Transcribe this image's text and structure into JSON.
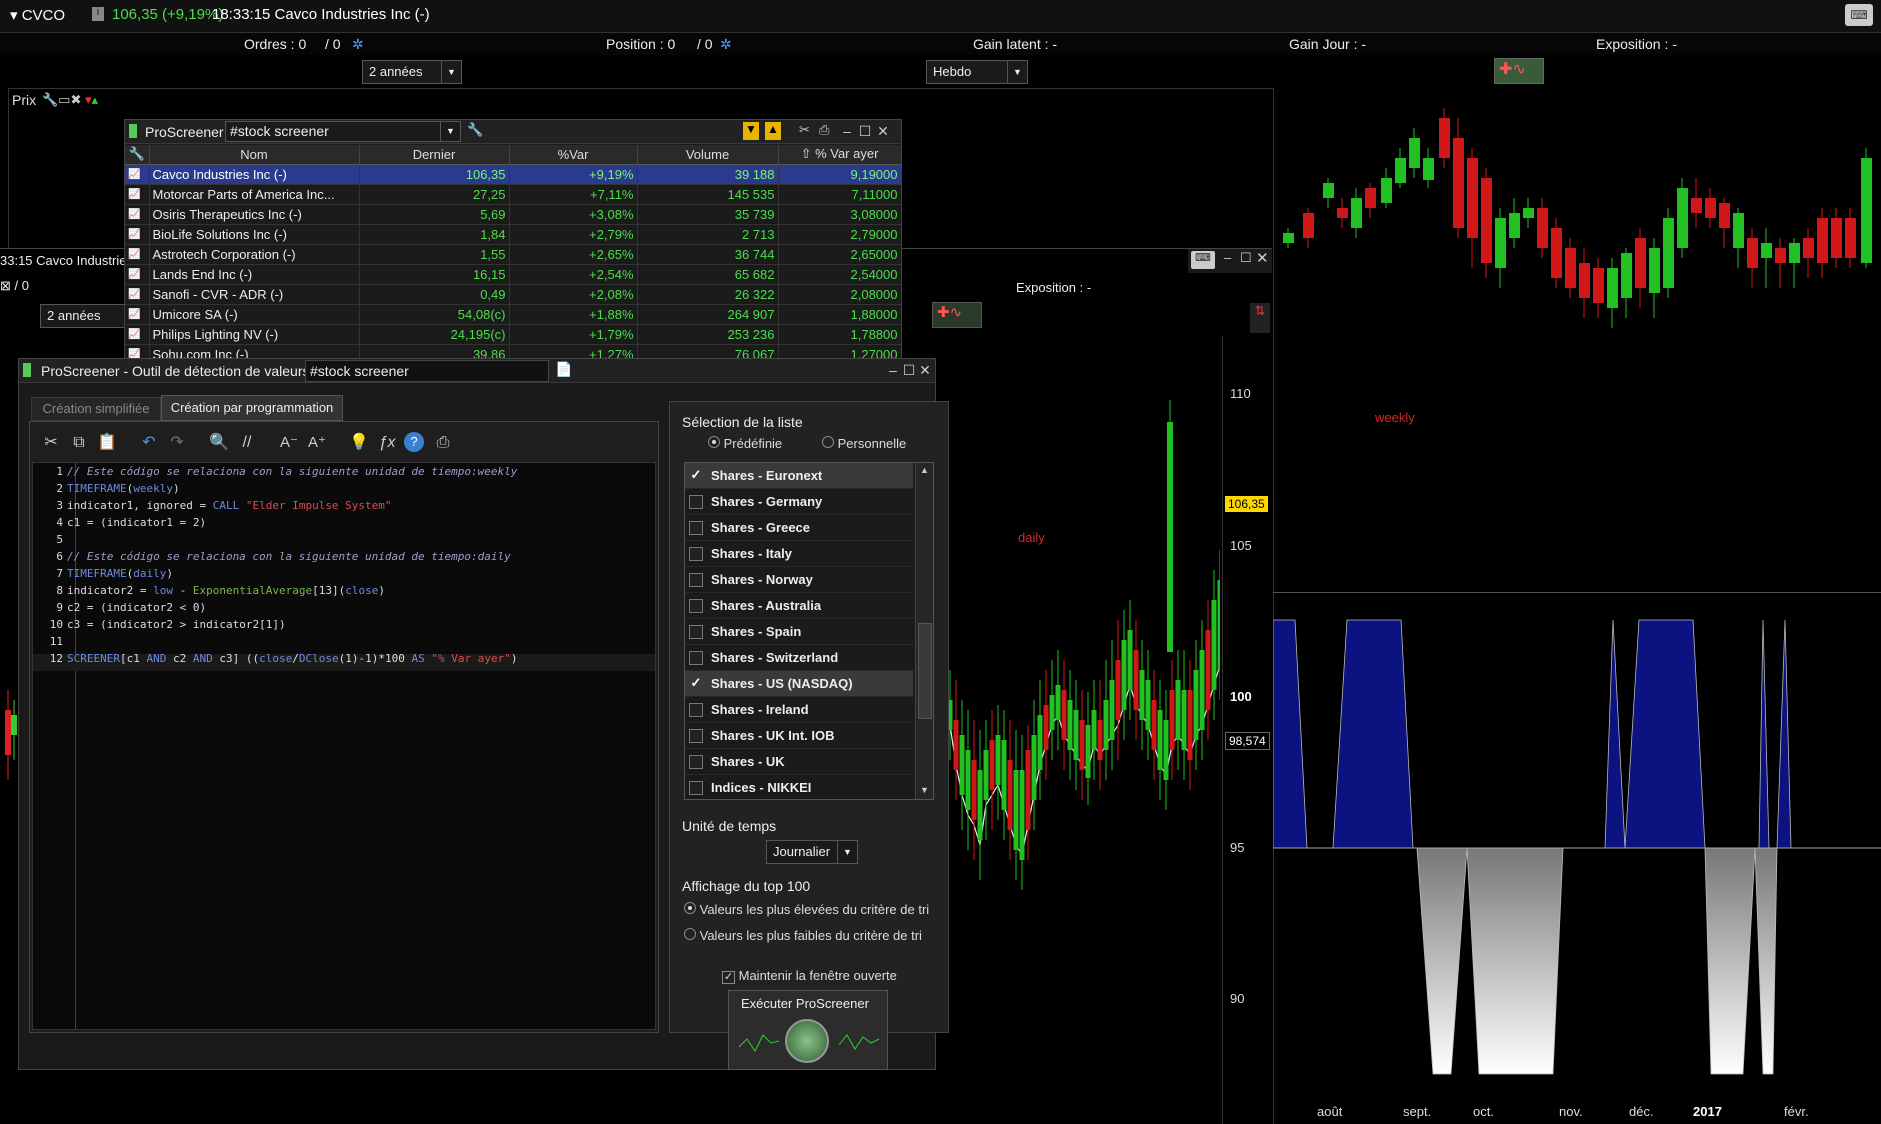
{
  "topbar": {
    "symbol": "▾ CVCO",
    "price": "106,35 (+9,19%)",
    "title": "18:33:15 Cavco Industries Inc (-)"
  },
  "infobar": {
    "orders": "Ordres : 0",
    "orders2": "/ 0",
    "position": "Position : 0",
    "position2": "/ 0",
    "gain_latent": "Gain latent : -",
    "gain_jour": "Gain Jour : -",
    "exposition": "Exposition : -"
  },
  "period_select": "2 années",
  "period_select2": "2 années",
  "freq_select": "Hebdo",
  "prix_label": "Prix",
  "back_window": {
    "title": "33:15 Cavco Industrie",
    "orders2": "/ 0",
    "exposition": "Exposition : -"
  },
  "chart_daily": {
    "label": "daily",
    "y_ticks": [
      "110",
      "105",
      "100",
      "95",
      "90"
    ],
    "last_price": "106,35",
    "ma_price": "98,574"
  },
  "chart_weekly": {
    "label": "weekly",
    "x_ticks": [
      "août",
      "sept.",
      "oct.",
      "nov.",
      "déc.",
      "2017",
      "févr."
    ]
  },
  "screener_window": {
    "title": "ProScreener",
    "screen_name": "#stock screener",
    "columns": [
      "Nom",
      "Dernier",
      "%Var",
      "Volume",
      "% Var ayer"
    ],
    "rows": [
      [
        "Cavco Industries Inc (-)",
        "106,35",
        "+9,19%",
        "39 188",
        "9,19000"
      ],
      [
        "Motorcar Parts of America Inc...",
        "27,25",
        "+7,11%",
        "145 535",
        "7,11000"
      ],
      [
        "Osiris Therapeutics Inc (-)",
        "5,69",
        "+3,08%",
        "35 739",
        "3,08000"
      ],
      [
        "BioLife Solutions Inc (-)",
        "1,84",
        "+2,79%",
        "2 713",
        "2,79000"
      ],
      [
        "Astrotech Corporation (-)",
        "1,55",
        "+2,65%",
        "36 744",
        "2,65000"
      ],
      [
        "Lands End Inc (-)",
        "16,15",
        "+2,54%",
        "65 682",
        "2,54000"
      ],
      [
        "Sanofi - CVR - ADR (-)",
        "0,49",
        "+2,08%",
        "26 322",
        "2,08000"
      ],
      [
        "Umicore SA (-)",
        "54,08(c)",
        "+1,88%",
        "264 907",
        "1,88000"
      ],
      [
        "Philips Lighting NV (-)",
        "24,195(c)",
        "+1,79%",
        "253 236",
        "1,78800"
      ],
      [
        "Sohu.com Inc (-)",
        "39,86",
        "+1,27%",
        "76 067",
        "1,27000"
      ]
    ]
  },
  "tool_window": {
    "title": "ProScreener - Outil de détection de valeurs  -",
    "screen_name": "#stock screener",
    "tabs": [
      "Création simplifiée",
      "Création par programmation"
    ],
    "code_lines": [
      "// Este código se relaciona con la siguiente unidad de tiempo:weekly",
      "TIMEFRAME(weekly)",
      "indicator1, ignored = CALL \"Elder Impulse System\"",
      "c1 = (indicator1 = 2)",
      "",
      "// Este código se relaciona con la siguiente unidad de tiempo:daily",
      "TIMEFRAME(daily)",
      "indicator2 = low - ExponentialAverage[13](close)",
      "c2 = (indicator2 < 0)",
      "c3 = (indicator2 > indicator2[1])",
      "",
      "SCREENER[c1 AND c2 AND c3] ((close/DClose(1)-1)*100 AS \"% Var ayer\")"
    ],
    "selection_title": "Sélection de la liste",
    "predefined": "Prédéfinie",
    "personal": "Personnelle",
    "lists": [
      {
        "label": "Shares - Euronext",
        "checked": true
      },
      {
        "label": "Shares - Germany",
        "checked": false
      },
      {
        "label": "Shares - Greece",
        "checked": false
      },
      {
        "label": "Shares - Italy",
        "checked": false
      },
      {
        "label": "Shares - Norway",
        "checked": false
      },
      {
        "label": "Shares - Australia",
        "checked": false
      },
      {
        "label": "Shares - Spain",
        "checked": false
      },
      {
        "label": "Shares - Switzerland",
        "checked": false
      },
      {
        "label": "Shares - US (NASDAQ)",
        "checked": true
      },
      {
        "label": "Shares - Ireland",
        "checked": false
      },
      {
        "label": "Shares - UK Int. IOB",
        "checked": false
      },
      {
        "label": "Shares - UK",
        "checked": false
      },
      {
        "label": "Indices - NIKKEI",
        "checked": false
      }
    ],
    "time_unit_label": "Unité de temps",
    "time_unit_value": "Journalier",
    "top100_label": "Affichage du top 100",
    "top100_high": "Valeurs les plus élevées du critère de tri",
    "top100_low": "Valeurs les plus faibles du critère de tri",
    "keep_open": "Maintenir la fenêtre ouverte",
    "run_button": "Exécuter ProScreener"
  }
}
